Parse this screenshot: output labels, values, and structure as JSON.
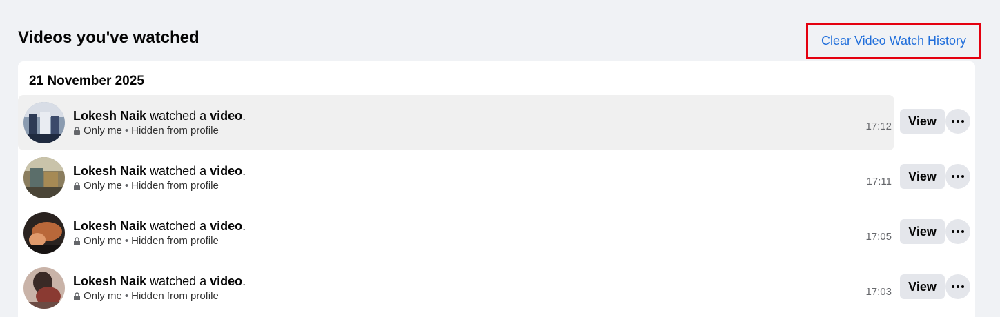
{
  "header": {
    "title": "Videos you've watched",
    "clear_link": "Clear Video Watch History"
  },
  "section": {
    "date": "21 November 2025"
  },
  "entries": [
    {
      "user": "Lokesh Naik",
      "action": "watched a",
      "object": "video",
      "suffix": ".",
      "privacy": "Only me",
      "separator": "•",
      "visibility": "Hidden from profile",
      "time": "17:12",
      "view_label": "View",
      "avatar_icon": "avatar-thumbnail-icon"
    },
    {
      "user": "Lokesh Naik",
      "action": "watched a",
      "object": "video",
      "suffix": ".",
      "privacy": "Only me",
      "separator": "•",
      "visibility": "Hidden from profile",
      "time": "17:11",
      "view_label": "View",
      "avatar_icon": "avatar-thumbnail-icon"
    },
    {
      "user": "Lokesh Naik",
      "action": "watched a",
      "object": "video",
      "suffix": ".",
      "privacy": "Only me",
      "separator": "•",
      "visibility": "Hidden from profile",
      "time": "17:05",
      "view_label": "View",
      "avatar_icon": "avatar-thumbnail-icon"
    },
    {
      "user": "Lokesh Naik",
      "action": "watched a",
      "object": "video",
      "suffix": ".",
      "privacy": "Only me",
      "separator": "•",
      "visibility": "Hidden from profile",
      "time": "17:03",
      "view_label": "View",
      "avatar_icon": "avatar-thumbnail-icon"
    }
  ],
  "colors": {
    "background": "#f0f2f5",
    "card": "#ffffff",
    "link": "#216fdb",
    "highlight_border": "#e4000f",
    "button": "#e4e6eb"
  }
}
